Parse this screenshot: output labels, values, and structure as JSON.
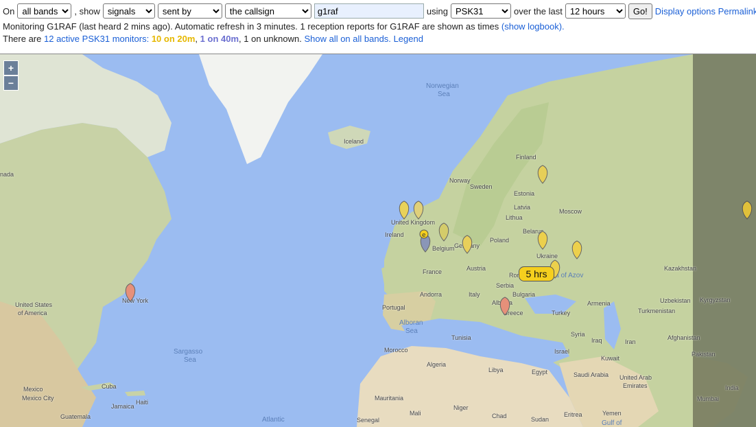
{
  "controls": {
    "prefix_on": "On",
    "band_select": "all bands",
    "word_show": ", show",
    "show_select": "signals",
    "direction_select": "sent by",
    "target_select": "the callsign",
    "callsign_value": "g1raf",
    "word_using": "using",
    "mode_select": "PSK31",
    "word_over": "over the last",
    "period_select": "12 hours",
    "go_label": "Go!",
    "display_options_link": "Display options",
    "permalink_link": "Permalink"
  },
  "status": {
    "line1_text": "Monitoring G1RAF (last heard 2 mins ago). Automatic refresh in 3 minutes. 1 reception reports for G1RAF are shown as times",
    "logbook_link": "(show logbook).",
    "line2_prefix": "There are",
    "active_link": "12 active PSK31 monitors:",
    "band20": "10 on 20m",
    "band40": "1 on 40m",
    "unknown_text": ", 1 on unknown.",
    "show_all_link": "Show all on all bands.",
    "legend_link": "Legend"
  },
  "map": {
    "zoom_in": "+",
    "zoom_out": "−",
    "bubble_text": "5 hrs",
    "labels": {
      "canada": "nada",
      "us": "United States",
      "us2": "of America",
      "newyork": "New York",
      "mexico": "Mexico",
      "mexicocity": "Mexico City",
      "cuba": "Cuba",
      "haiti": "Haiti",
      "jamaica": "Jamaica",
      "guatemala": "Guatemala",
      "sargasso": "Sargasso",
      "sargasso2": "Sea",
      "atlantic": "Atlantic",
      "iceland": "Iceland",
      "norwegian": "Norwegian",
      "norwegian2": "Sea",
      "finland": "Finland",
      "norway": "Norway",
      "sweden": "Sweden",
      "estonia": "Estonia",
      "latvia": "Latvia",
      "lithuania": "Lithua",
      "moscow": "Moscow",
      "uk": "United Kingdom",
      "ireland": "Ireland",
      "belarus": "Belarus",
      "poland": "Poland",
      "belgium": "Belgium",
      "germany": "Germany",
      "ukraine": "Ukraine",
      "france": "France",
      "austria": "Austria",
      "romania": "Romania",
      "azov": "Sea of Azov",
      "kazakhstan": "Kazakhstan",
      "serbia": "Serbia",
      "andorra": "Andorra",
      "italy": "Italy",
      "bulgaria": "Bulgaria",
      "portugal": "Portugal",
      "albania": "Albania",
      "greece": "Greece",
      "turkey": "Turkey",
      "armenia": "Armenia",
      "uzbekistan": "Uzbekistan",
      "kyrgyzstan": "Kyrgyzstan",
      "turkmenistan": "Turkmenistan",
      "alboran": "Alboran",
      "alboran2": "Sea",
      "tunisia": "Tunisia",
      "syria": "Syria",
      "iraq": "Iraq",
      "iran": "Iran",
      "afghanistan": "Afghanistan",
      "morocco": "Morocco",
      "israel": "Israel",
      "kuwait": "Kuwait",
      "pakistan": "Pakistan",
      "algeria": "Algeria",
      "libya": "Libya",
      "egypt": "Egypt",
      "saudi": "Saudi Arabia",
      "uae": "United Arab",
      "uae2": "Emirates",
      "india": "India",
      "mauritania": "Mauritania",
      "mali": "Mali",
      "niger": "Niger",
      "chad": "Chad",
      "sudan": "Sudan",
      "eritrea": "Eritrea",
      "yemen": "Yemen",
      "mumbai": "Mumbai",
      "senegal": "Senegal",
      "gulf": "Gulf of"
    }
  }
}
